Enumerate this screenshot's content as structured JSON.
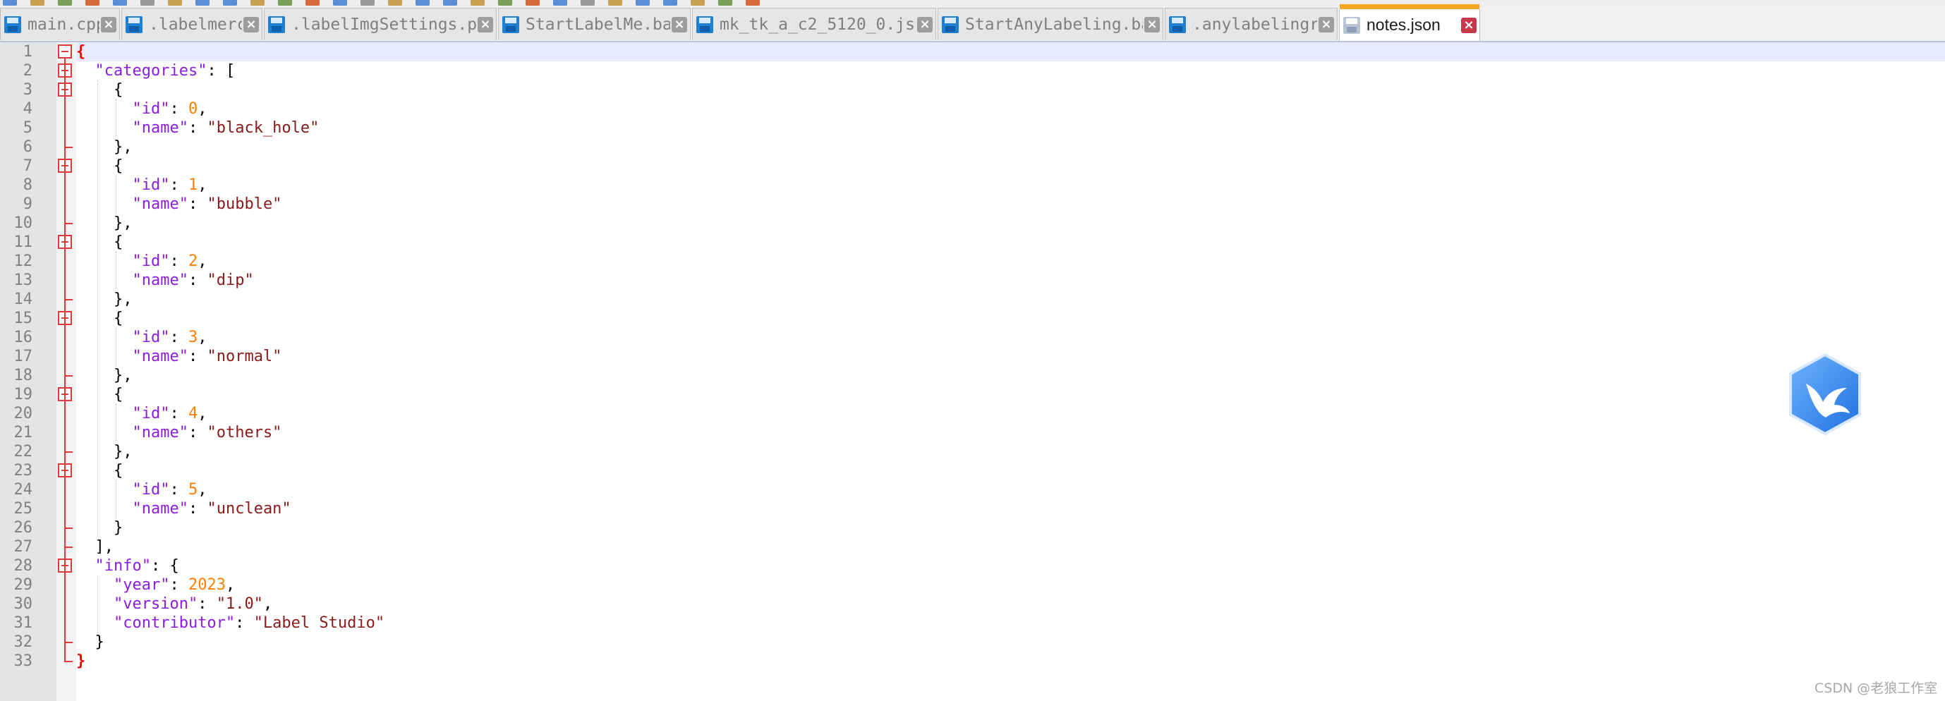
{
  "tabs": [
    {
      "label": "main.cpp",
      "active": false
    },
    {
      "label": ".labelmerc",
      "active": false
    },
    {
      "label": ".labelImgSettings.pkl",
      "active": false
    },
    {
      "label": "StartLabelMe.bat",
      "active": false
    },
    {
      "label": "mk_tk_a_c2_5120_0.json",
      "active": false
    },
    {
      "label": "StartAnyLabeling.bat",
      "active": false
    },
    {
      "label": ".anylabelingrc",
      "active": false
    },
    {
      "label": "notes.json",
      "active": true
    }
  ],
  "icons": {
    "tab_save": "floppy-disk-icon",
    "tab_close": "close-icon",
    "watermark_logo": "bird-hexagon-icon"
  },
  "colors": {
    "active_tab_accent": "#f6a623",
    "close_active": "#c9374d",
    "key": "#8c1de0",
    "string": "#8b1a1a",
    "number": "#ff8000",
    "fold_marker": "#e03a3a"
  },
  "editor": {
    "line_numbers": [
      "1",
      "2",
      "3",
      "4",
      "5",
      "6",
      "7",
      "8",
      "9",
      "10",
      "11",
      "12",
      "13",
      "14",
      "15",
      "16",
      "17",
      "18",
      "19",
      "20",
      "21",
      "22",
      "23",
      "24",
      "25",
      "26",
      "27",
      "28",
      "29",
      "30",
      "31",
      "32",
      "33"
    ],
    "lines": [
      [
        {
          "t": "{",
          "c": "pb"
        }
      ],
      [
        {
          "t": "  "
        },
        {
          "t": "\"categories\"",
          "c": "k"
        },
        {
          "t": ": ["
        }
      ],
      [
        {
          "t": "    {"
        }
      ],
      [
        {
          "t": "      "
        },
        {
          "t": "\"id\"",
          "c": "k"
        },
        {
          "t": ": "
        },
        {
          "t": "0",
          "c": "n"
        },
        {
          "t": ","
        }
      ],
      [
        {
          "t": "      "
        },
        {
          "t": "\"name\"",
          "c": "k"
        },
        {
          "t": ": "
        },
        {
          "t": "\"black_hole\"",
          "c": "s"
        }
      ],
      [
        {
          "t": "    },"
        }
      ],
      [
        {
          "t": "    {"
        }
      ],
      [
        {
          "t": "      "
        },
        {
          "t": "\"id\"",
          "c": "k"
        },
        {
          "t": ": "
        },
        {
          "t": "1",
          "c": "n"
        },
        {
          "t": ","
        }
      ],
      [
        {
          "t": "      "
        },
        {
          "t": "\"name\"",
          "c": "k"
        },
        {
          "t": ": "
        },
        {
          "t": "\"bubble\"",
          "c": "s"
        }
      ],
      [
        {
          "t": "    },"
        }
      ],
      [
        {
          "t": "    {"
        }
      ],
      [
        {
          "t": "      "
        },
        {
          "t": "\"id\"",
          "c": "k"
        },
        {
          "t": ": "
        },
        {
          "t": "2",
          "c": "n"
        },
        {
          "t": ","
        }
      ],
      [
        {
          "t": "      "
        },
        {
          "t": "\"name\"",
          "c": "k"
        },
        {
          "t": ": "
        },
        {
          "t": "\"dip\"",
          "c": "s"
        }
      ],
      [
        {
          "t": "    },"
        }
      ],
      [
        {
          "t": "    {"
        }
      ],
      [
        {
          "t": "      "
        },
        {
          "t": "\"id\"",
          "c": "k"
        },
        {
          "t": ": "
        },
        {
          "t": "3",
          "c": "n"
        },
        {
          "t": ","
        }
      ],
      [
        {
          "t": "      "
        },
        {
          "t": "\"name\"",
          "c": "k"
        },
        {
          "t": ": "
        },
        {
          "t": "\"normal\"",
          "c": "s"
        }
      ],
      [
        {
          "t": "    },"
        }
      ],
      [
        {
          "t": "    {"
        }
      ],
      [
        {
          "t": "      "
        },
        {
          "t": "\"id\"",
          "c": "k"
        },
        {
          "t": ": "
        },
        {
          "t": "4",
          "c": "n"
        },
        {
          "t": ","
        }
      ],
      [
        {
          "t": "      "
        },
        {
          "t": "\"name\"",
          "c": "k"
        },
        {
          "t": ": "
        },
        {
          "t": "\"others\"",
          "c": "s"
        }
      ],
      [
        {
          "t": "    },"
        }
      ],
      [
        {
          "t": "    {"
        }
      ],
      [
        {
          "t": "      "
        },
        {
          "t": "\"id\"",
          "c": "k"
        },
        {
          "t": ": "
        },
        {
          "t": "5",
          "c": "n"
        },
        {
          "t": ","
        }
      ],
      [
        {
          "t": "      "
        },
        {
          "t": "\"name\"",
          "c": "k"
        },
        {
          "t": ": "
        },
        {
          "t": "\"unclean\"",
          "c": "s"
        }
      ],
      [
        {
          "t": "    }"
        }
      ],
      [
        {
          "t": "  ],"
        }
      ],
      [
        {
          "t": "  "
        },
        {
          "t": "\"info\"",
          "c": "k"
        },
        {
          "t": ": {"
        }
      ],
      [
        {
          "t": "    "
        },
        {
          "t": "\"year\"",
          "c": "k"
        },
        {
          "t": ": "
        },
        {
          "t": "2023",
          "c": "n"
        },
        {
          "t": ","
        }
      ],
      [
        {
          "t": "    "
        },
        {
          "t": "\"version\"",
          "c": "k"
        },
        {
          "t": ": "
        },
        {
          "t": "\"1.0\"",
          "c": "s"
        },
        {
          "t": ","
        }
      ],
      [
        {
          "t": "    "
        },
        {
          "t": "\"contributor\"",
          "c": "k"
        },
        {
          "t": ": "
        },
        {
          "t": "\"Label Studio\"",
          "c": "s"
        }
      ],
      [
        {
          "t": "  }"
        }
      ],
      [
        {
          "t": "}",
          "c": "pb"
        }
      ]
    ],
    "fold_lines": [
      1,
      2,
      3,
      7,
      11,
      15,
      19,
      23,
      28
    ]
  },
  "watermark": "CSDN @老狼工作室"
}
